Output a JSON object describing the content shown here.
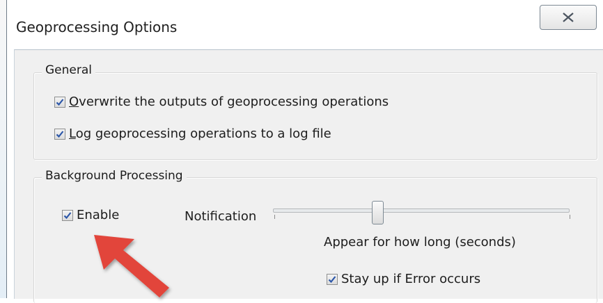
{
  "dialog": {
    "title": "Geoprocessing Options",
    "close_icon": "close-icon"
  },
  "general": {
    "legend": "General",
    "overwrite": {
      "accel": "O",
      "rest": "verwrite the outputs of geoprocessing operations",
      "checked": true
    },
    "log": {
      "accel": "L",
      "rest": "og geoprocessing operations to a log file",
      "checked": true
    }
  },
  "background": {
    "legend": "Background Processing",
    "enable": {
      "label": "Enable",
      "checked": true
    },
    "notification_label": "Notification",
    "slider_label": "Appear for how long (seconds)",
    "stay_up": {
      "label": "Stay up if Error occurs",
      "checked": true
    }
  },
  "annotation": {
    "icon": "red-arrow-icon",
    "color": "#e2453b"
  },
  "colors": {
    "check": "#2b56a8",
    "accent": "#e2453b"
  }
}
